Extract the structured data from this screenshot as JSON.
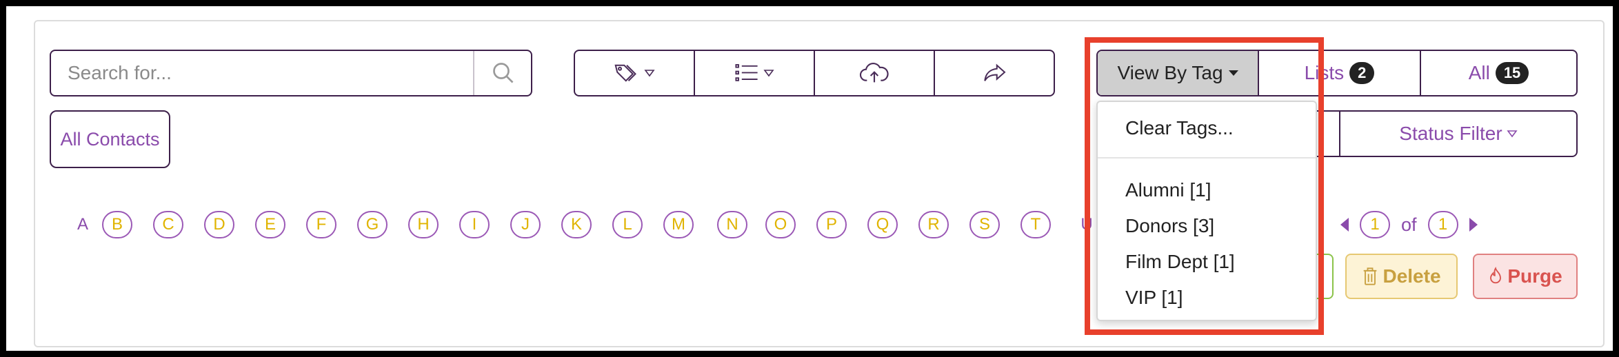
{
  "search": {
    "placeholder": "Search for..."
  },
  "toolbar": {
    "tools": [
      {
        "icon": "tag-icon"
      },
      {
        "icon": "list-icon"
      },
      {
        "icon": "cloud-upload-icon"
      },
      {
        "icon": "share-icon"
      }
    ]
  },
  "views": {
    "view_by_tag": "View By Tag",
    "lists_label": "Lists",
    "lists_count": "2",
    "all_label": "All",
    "all_count": "15"
  },
  "all_contacts": "All Contacts",
  "status_filter": "Status Filter",
  "alphabet": [
    "A",
    "B",
    "C",
    "D",
    "E",
    "F",
    "G",
    "H",
    "I",
    "J",
    "K",
    "L",
    "M",
    "N",
    "O",
    "P",
    "Q",
    "R",
    "S",
    "T",
    "U"
  ],
  "pager": {
    "current": "1",
    "of": "of",
    "total": "1"
  },
  "actions": {
    "delete": "Delete",
    "purge": "Purge"
  },
  "tag_menu": {
    "clear": "Clear Tags...",
    "items": [
      "Alumni [1]",
      "Donors [3]",
      "Film Dept [1]",
      "VIP [1]"
    ]
  },
  "colors": {
    "accent": "#8a4bab",
    "border": "#3d1f4a",
    "letter": "#e0b400",
    "highlight": "#e8402c"
  }
}
